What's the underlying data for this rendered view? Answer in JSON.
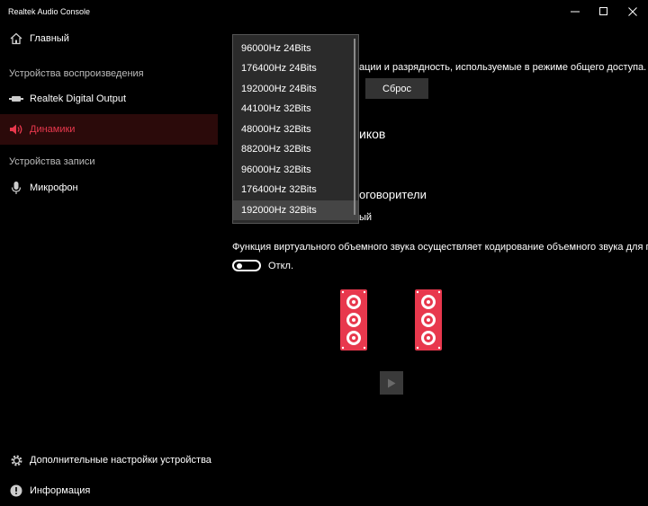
{
  "window": {
    "title": "Realtek Audio Console",
    "controls": [
      "minimize",
      "maximize",
      "close"
    ]
  },
  "sidebar": {
    "home_label": "Главный",
    "playback_section": "Устройства воспроизведения",
    "playback_items": [
      {
        "label": "Realtek Digital Output",
        "icon": "digital-output-icon"
      },
      {
        "label": "Динамики",
        "icon": "speaker-icon",
        "active": true
      }
    ],
    "recording_section": "Устройства записи",
    "recording_items": [
      {
        "label": "Микрофон",
        "icon": "microphone-icon"
      }
    ],
    "footer_items": [
      {
        "label": "Дополнительные настройки устройства",
        "icon": "gear-icon"
      },
      {
        "label": "Информация",
        "icon": "info-icon"
      }
    ]
  },
  "main": {
    "format_desc_partial": "ации и разрядность, используемые в режиме общего доступа.",
    "reset_label": "Сброс",
    "heading_partial": "иков",
    "speakers_partial": "оговорители",
    "small_partial": "ый",
    "virtual_surround_desc": "Функция виртуального объемного звука осуществляет кодирование объемного звука для пере",
    "toggle_label": "Откл.",
    "toggle_state": false
  },
  "dropdown": {
    "options": [
      "96000Hz 24Bits",
      "176400Hz 24Bits",
      "192000Hz 24Bits",
      "44100Hz 32Bits",
      "48000Hz 32Bits",
      "88200Hz 32Bits",
      "96000Hz 32Bits",
      "176400Hz 32Bits",
      "192000Hz 32Bits"
    ],
    "selected_index": 8
  },
  "colors": {
    "accent": "#e8384d",
    "active_bg": "#2b0a0a",
    "dropdown_bg": "#2b2b2b",
    "background": "#000000"
  }
}
